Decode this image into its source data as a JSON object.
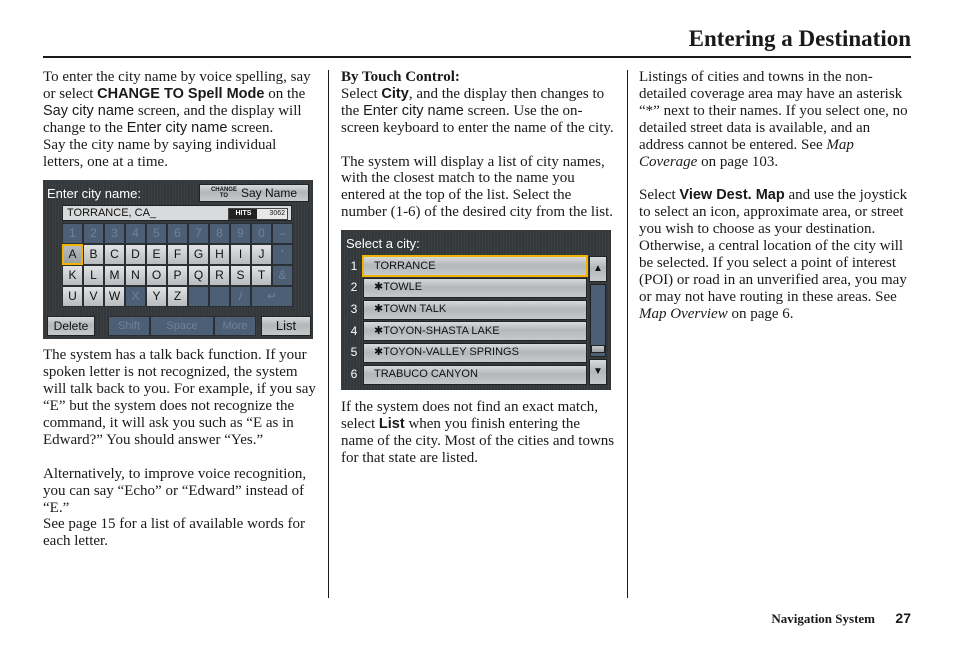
{
  "header": {
    "title": "Entering a Destination"
  },
  "footer": {
    "section": "Navigation System",
    "page_number": "27"
  },
  "column1": {
    "p1": {
      "t1": "To enter the city name by voice spelling, say or select ",
      "b1": "CHANGE TO Spell Mode",
      "t2": " on the ",
      "s1": "Say city name",
      "t3": " screen, and the display will change to the ",
      "s2": "Enter city name",
      "t4": " screen.",
      "t5": "Say the city name by saying individual letters, one at a time."
    },
    "p2": "The system has a talk back function. If your spoken letter is not recognized, the system will talk back to you. For example, if you say “E” but the system does not recognize the command, it will ask you such as “E as in Edward?” You should answer “Yes.”",
    "p3": {
      "t1": "Alternatively, to improve voice recognition, you can say “Echo” or “Edward” instead of “E.”",
      "t2": "See page 15 for a list of available words for each letter."
    }
  },
  "column2": {
    "heading": "By Touch Control:",
    "p1": {
      "t1": "Select ",
      "b1": "City",
      "t2": ", and the display then changes to the ",
      "s1": "Enter city name",
      "t3": " screen. Use the on-screen keyboard to enter the name of the city."
    },
    "p2": "The system will display a list of city names, with the closest match to the name you entered at the top of the list. Select the number (1-6) of the desired city from the list.",
    "p3": {
      "t1": "If the system does not find an exact match, select ",
      "b1": "List",
      "t2": " when you finish entering the name of the city. Most of the cities and towns for that state are listed."
    }
  },
  "column3": {
    "p1": {
      "t1": "Listings of cities and towns in the non-detailed coverage area may have an asterisk “*” next to their names. If you select one, no detailed street data is available, and an address cannot be entered. See ",
      "i1": "Map Coverage",
      "t2": " on page 103."
    },
    "p2": {
      "t1": "Select ",
      "b1": "View Dest. Map",
      "t2": " and use the joystick to select an icon, approximate area, or street you wish to choose as your destination. Otherwise, a central location of the city will be selected. If you select a point of interest (POI) or road in an unverified area, you may or may not have routing in these areas. See ",
      "i1": "Map Overview",
      "t3": " on page 6."
    }
  },
  "keyboard_screen": {
    "title": "Enter city name:",
    "change_btn": {
      "small_top": "CHANGE",
      "small_bottom": "TO",
      "label": "Say Name"
    },
    "entry_value": "TORRANCE, CA_",
    "hits_label": "HITS",
    "hits_value": "3062",
    "rows": [
      [
        {
          "k": "1",
          "s": "off"
        },
        {
          "k": "2",
          "s": "off"
        },
        {
          "k": "3",
          "s": "off"
        },
        {
          "k": "4",
          "s": "off"
        },
        {
          "k": "5",
          "s": "off"
        },
        {
          "k": "6",
          "s": "off"
        },
        {
          "k": "7",
          "s": "off"
        },
        {
          "k": "8",
          "s": "off"
        },
        {
          "k": "9",
          "s": "off"
        },
        {
          "k": "0",
          "s": "off"
        },
        {
          "k": "–",
          "s": "off"
        }
      ],
      [
        {
          "k": "A",
          "s": "sel"
        },
        {
          "k": "B",
          "s": "on"
        },
        {
          "k": "C",
          "s": "on"
        },
        {
          "k": "D",
          "s": "on"
        },
        {
          "k": "E",
          "s": "on"
        },
        {
          "k": "F",
          "s": "on"
        },
        {
          "k": "G",
          "s": "on"
        },
        {
          "k": "H",
          "s": "on"
        },
        {
          "k": "I",
          "s": "on"
        },
        {
          "k": "J",
          "s": "on"
        },
        {
          "k": "'",
          "s": "off"
        }
      ],
      [
        {
          "k": "K",
          "s": "on"
        },
        {
          "k": "L",
          "s": "on"
        },
        {
          "k": "M",
          "s": "on"
        },
        {
          "k": "N",
          "s": "on"
        },
        {
          "k": "O",
          "s": "on"
        },
        {
          "k": "P",
          "s": "on"
        },
        {
          "k": "Q",
          "s": "on"
        },
        {
          "k": "R",
          "s": "on"
        },
        {
          "k": "S",
          "s": "on"
        },
        {
          "k": "T",
          "s": "on"
        },
        {
          "k": "&",
          "s": "off"
        }
      ],
      [
        {
          "k": "U",
          "s": "on"
        },
        {
          "k": "V",
          "s": "on"
        },
        {
          "k": "W",
          "s": "on"
        },
        {
          "k": "X",
          "s": "off"
        },
        {
          "k": "Y",
          "s": "on"
        },
        {
          "k": "Z",
          "s": "on"
        },
        {
          "k": "",
          "s": "off"
        },
        {
          "k": "",
          "s": "off"
        },
        {
          "k": "/",
          "s": "off"
        },
        {
          "k": "↵",
          "s": "off",
          "wide": true
        }
      ]
    ],
    "delete_label": "Delete",
    "shift_label": "Shift",
    "space_label": "Space",
    "more_label": "More",
    "list_label": "List"
  },
  "city_screen": {
    "title": "Select a city:",
    "cities": [
      {
        "num": "1",
        "name": "TORRANCE",
        "selected": true
      },
      {
        "num": "2",
        "name": "✱TOWLE"
      },
      {
        "num": "3",
        "name": "✱TOWN TALK"
      },
      {
        "num": "4",
        "name": "✱TOYON-SHASTA LAKE"
      },
      {
        "num": "5",
        "name": "✱TOYON-VALLEY SPRINGS"
      },
      {
        "num": "6",
        "name": "TRABUCO CANYON"
      }
    ],
    "scroll_position": 0.95,
    "scroll_up_icon": "▲",
    "scroll_down_icon": "▼"
  }
}
